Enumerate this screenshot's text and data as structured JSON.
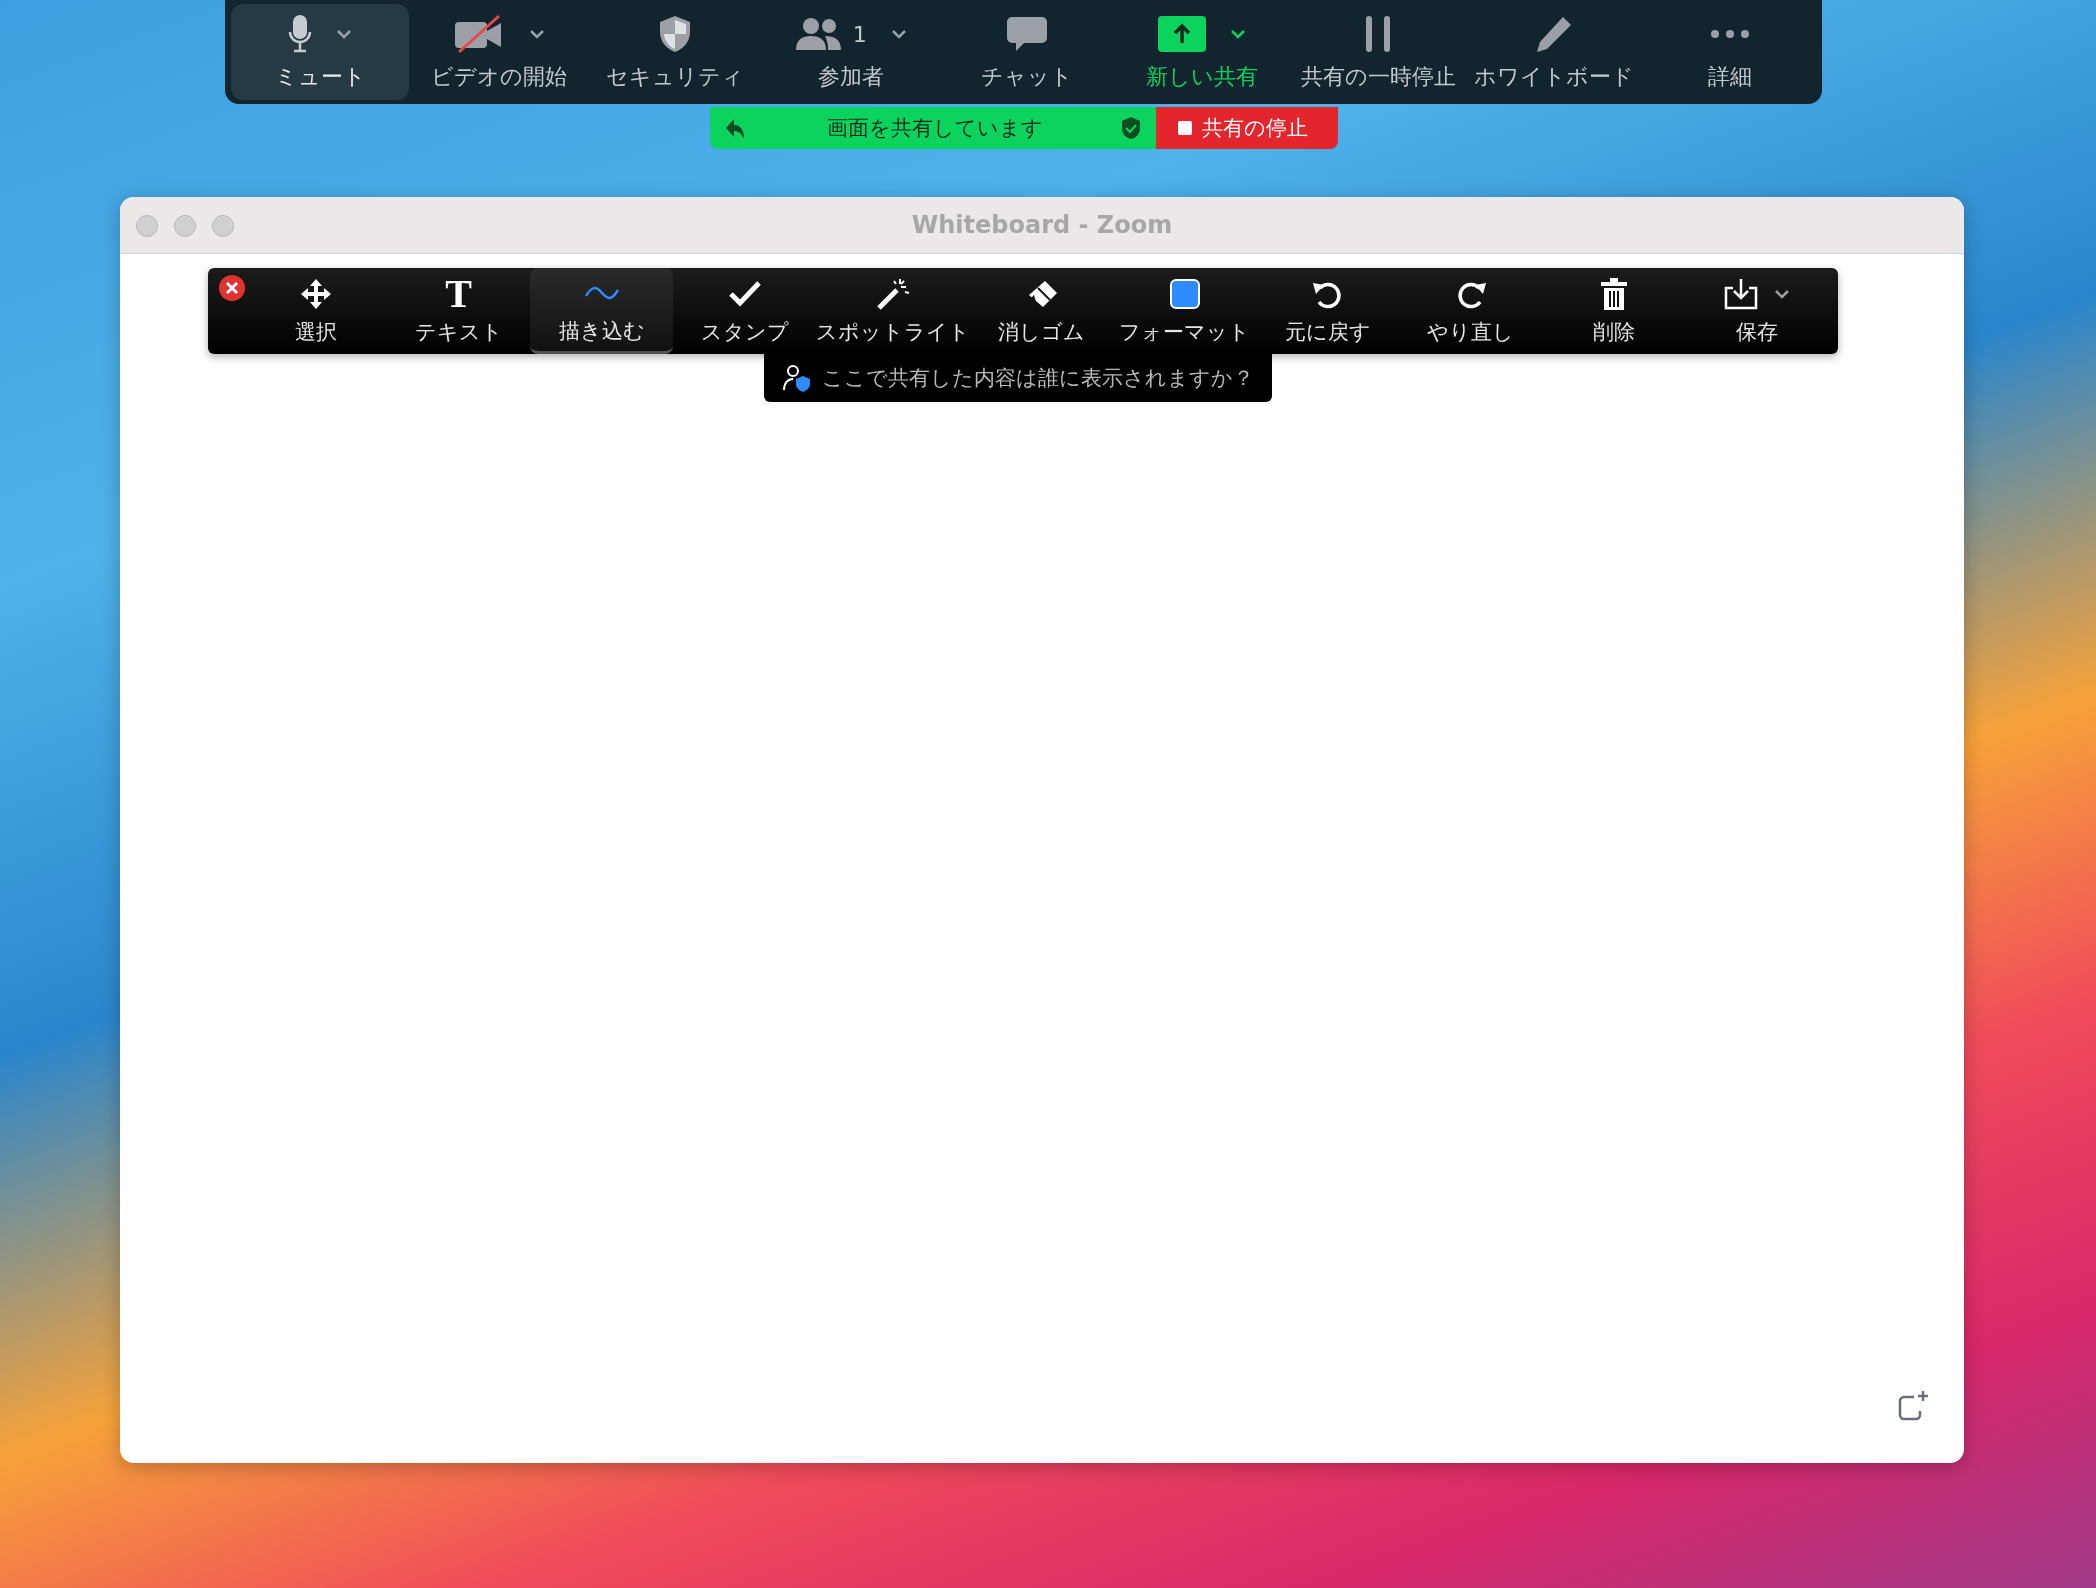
{
  "meeting_toolbar": {
    "items": [
      {
        "label": "ミュート",
        "selected": true,
        "active": false,
        "has_menu": true
      },
      {
        "label": "ビデオの開始",
        "selected": false,
        "active": false,
        "has_menu": true
      },
      {
        "label": "セキュリティ",
        "selected": false,
        "active": false,
        "has_menu": false
      },
      {
        "label": "参加者",
        "count": "1",
        "selected": false,
        "active": false,
        "has_menu": true
      },
      {
        "label": "チャット",
        "selected": false,
        "active": false,
        "has_menu": false
      },
      {
        "label": "新しい共有",
        "selected": false,
        "active": true,
        "has_menu": true
      },
      {
        "label": "共有の一時停止",
        "selected": false,
        "active": false,
        "has_menu": false
      },
      {
        "label": "ホワイトボード",
        "selected": false,
        "active": false,
        "has_menu": false
      },
      {
        "label": "詳細",
        "selected": false,
        "active": false,
        "has_menu": false
      }
    ]
  },
  "share_banner": {
    "status": "画面を共有しています",
    "stop_button": "共有の停止"
  },
  "window": {
    "title": "Whiteboard - Zoom"
  },
  "whiteboard_toolbar": {
    "tools": [
      {
        "label": "選択",
        "selected": false,
        "has_menu": false
      },
      {
        "label": "テキスト",
        "glyph": "T",
        "selected": false,
        "has_menu": false
      },
      {
        "label": "描き込む",
        "selected": true,
        "has_menu": false
      },
      {
        "label": "スタンプ",
        "selected": false,
        "has_menu": false
      },
      {
        "label": "スポットライト",
        "selected": false,
        "has_menu": false
      },
      {
        "label": "消しゴム",
        "selected": false,
        "has_menu": false
      },
      {
        "label": "フォーマット",
        "color": "#2d8cff",
        "selected": false,
        "has_menu": false
      },
      {
        "label": "元に戻す",
        "selected": false,
        "has_menu": false
      },
      {
        "label": "やり直し",
        "selected": false,
        "has_menu": false
      },
      {
        "label": "削除",
        "selected": false,
        "has_menu": false
      },
      {
        "label": "保存",
        "selected": false,
        "has_menu": true
      }
    ],
    "tooltip": "ここで共有した内容は誰に表示されますか？"
  }
}
